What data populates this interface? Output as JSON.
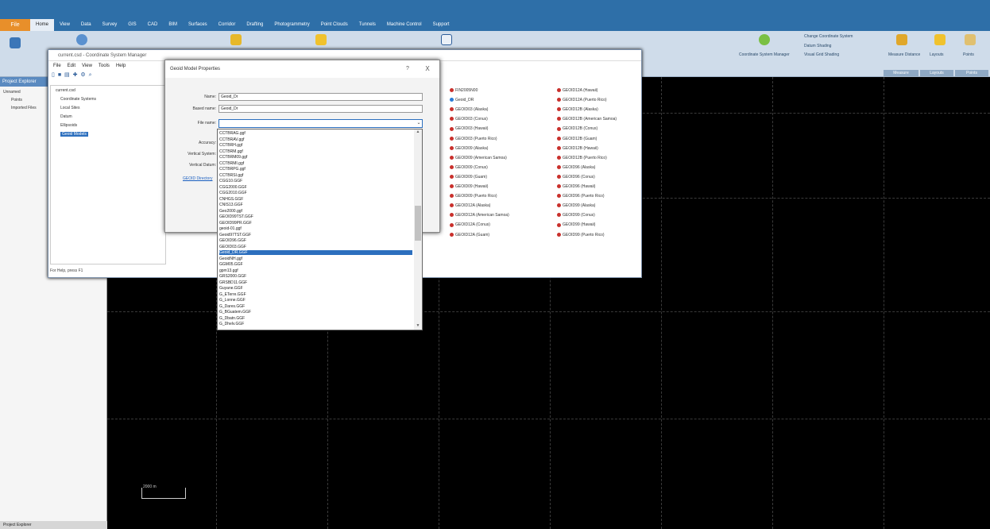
{
  "app": {
    "file_tab": "File",
    "ribbon_tabs": [
      "Home",
      "View",
      "Data",
      "Survey",
      "GIS",
      "CAD",
      "BIM",
      "Surfaces",
      "Corridor",
      "Drafting",
      "Photogrammetry",
      "Point Clouds",
      "Tunnels",
      "Machine Control",
      "Support"
    ],
    "active_tab": "Home",
    "ribbon_groups": [
      "Measure",
      "Layouts",
      "Points"
    ],
    "ribbon_texts": [
      "Change Coordinate System",
      "Datum Shading",
      "Visual Grid Shading",
      "Coordinate System Manager",
      "Measure Distance",
      "Layouts",
      "Points"
    ]
  },
  "project_pane": {
    "title": "Project Explorer",
    "items": [
      "Unnamed",
      "Points",
      "Imported Files"
    ],
    "bottom_tab": "Project Explorer"
  },
  "csm": {
    "title": "current.csd - Coordinate System Manager",
    "menu": [
      "File",
      "Edit",
      "View",
      "Tools",
      "Help"
    ],
    "tree": [
      {
        "label": "current.csd",
        "selected": false
      },
      {
        "label": "Coordinate Systems",
        "selected": false
      },
      {
        "label": "Local Sites",
        "selected": false
      },
      {
        "label": "Datum",
        "selected": false
      },
      {
        "label": "Ellipsoids",
        "selected": false
      },
      {
        "label": "Geoid Models",
        "selected": true
      }
    ],
    "status": "For Help, press F1",
    "geoids_col1": [
      "FIN2005N00",
      "Geoid_DR",
      "GEOID03 (Alaska)",
      "GEOID03 (Conus)",
      "GEOID03 (Hawaii)",
      "GEOID03 (Puerto Rico)",
      "GEOID09 (Alaska)",
      "GEOID09 (American Samoa)",
      "GEOID09 (Conus)",
      "GEOID09 (Guam)",
      "GEOID09 (Hawaii)",
      "GEOID09 (Puerto Rico)",
      "GEOID12A (Alaska)",
      "GEOID12A (American Samoa)",
      "GEOID12A (Conus)",
      "GEOID12A (Guam)"
    ],
    "geoids_col2": [
      "GEOID12A (Hawaii)",
      "GEOID12A (Puerto Rico)",
      "GEOID12B (Alaska)",
      "GEOID12B (American Samoa)",
      "GEOID12B (Conus)",
      "GEOID12B (Guam)",
      "GEOID12B (Hawaii)",
      "GEOID12B (Puerto Rico)",
      "GEOID96 (Alaska)",
      "GEOID96 (Conus)",
      "GEOID96 (Hawaii)",
      "GEOID96 (Puerto Rico)",
      "GEOID99 (Alaska)",
      "GEOID99 (Conus)",
      "GEOID99 (Hawaii)",
      "GEOID99 (Puerto Rico)"
    ]
  },
  "dialog": {
    "title": "Geoid Model Properties",
    "help": "?",
    "close": "X",
    "name_label": "Name:",
    "name_value": "Geoid_Dr",
    "based_label": "Based name:",
    "based_value": "Geoid_Dr",
    "file_label": "File name:",
    "file_value": "",
    "accuracy_label": "Accuracy:",
    "vsys_label": "Vertical System:",
    "vdatum_label": "Vertical Datum:",
    "link": "GEOID Directory"
  },
  "dropdown": {
    "items": [
      "CCTBRAG.ggf",
      "CCTBRAV.ggf",
      "CCTBRH.ggf",
      "CCTBRM.ggf",
      "CCTBRM09.ggf",
      "CCTBRMI.ggf",
      "CCTBRPG.ggf",
      "CCTBRSI.ggf",
      "CGG10.GGF",
      "CGG2000.GGF",
      "CGG2010.GGF",
      "CNHGS.GGF",
      "CNIS13.GGF",
      "Geo2000.ggf",
      "GEOID99TST.GGF",
      "GEOID99PR.GGF",
      "geoid-01.ggf",
      "Geoid97TST.GGF",
      "GEOID96.GGF",
      "GEOID03.GGF",
      "Geoid_DR.GGF",
      "GeoidNH.ggf",
      "GGM05.GGF",
      "gpm13.ggf",
      "GRS2000.GGF",
      "GRSBD11.GGF",
      "Guyane.GGF",
      "G_ETerre.GGF",
      "G_Lonne.GGF",
      "G_Dares.GGF",
      "G_BGuatem.GGF",
      "G_Dbatn.GGF",
      "G_Dhelv.GGF"
    ],
    "selected_index": 20
  },
  "canvas": {
    "scale_label": "2000 m"
  }
}
